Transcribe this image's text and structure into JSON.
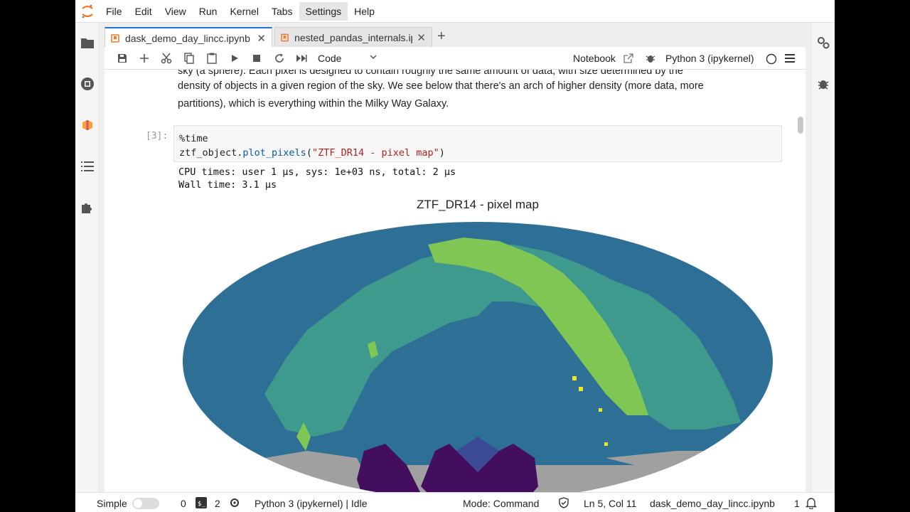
{
  "menu": [
    "File",
    "Edit",
    "View",
    "Run",
    "Kernel",
    "Tabs",
    "Settings",
    "Help"
  ],
  "tabs": [
    {
      "label": "dask_demo_day_lincc.ipynb",
      "active": true
    },
    {
      "label": "nested_pandas_internals.ipynb",
      "active": false
    }
  ],
  "toolbar": {
    "cell_type": "Code",
    "notebook_label": "Notebook",
    "kernel": "Python 3 (ipykernel)"
  },
  "notebook": {
    "md_lines": [
      "sky (a sphere). Each pixel is designed to contain roughly the same amount of data, with size determined by the",
      "density of objects in a given region of the sky. We see below that there's an arch of higher density (more data, more",
      "partitions), which is everything within the Milky Way Galaxy."
    ],
    "prompt": "[3]:",
    "code": {
      "line1": "%time",
      "line2_var": "ztf_object.",
      "line2_fn": "plot_pixels",
      "line2_open": "(",
      "line2_str": "\"ZTF_DR14 - pixel map\"",
      "line2_close": ")"
    },
    "output_lines": [
      "CPU times: user 1 µs, sys: 1e+03 ns, total: 2 µs",
      "Wall time: 3.1 µs"
    ],
    "plot_title": "ZTF_DR14 - pixel map"
  },
  "colors": {
    "accent": "#1976d2",
    "map_dark_blue": "#2e6f95",
    "map_teal": "#3e9a8c",
    "map_green": "#80c655",
    "map_yellow": "#f3e51e",
    "map_purple": "#440e5e",
    "map_indigo": "#3b4a94",
    "map_grey": "#a0a0a0"
  },
  "status": {
    "mode_label": "Simple",
    "terminals": "0",
    "kernels": "2",
    "kernel_status": "Python 3 (ipykernel) | Idle",
    "mode": "Mode: Command",
    "position": "Ln 5, Col 11",
    "file": "dask_demo_day_lincc.ipynb",
    "notifications": "1"
  }
}
